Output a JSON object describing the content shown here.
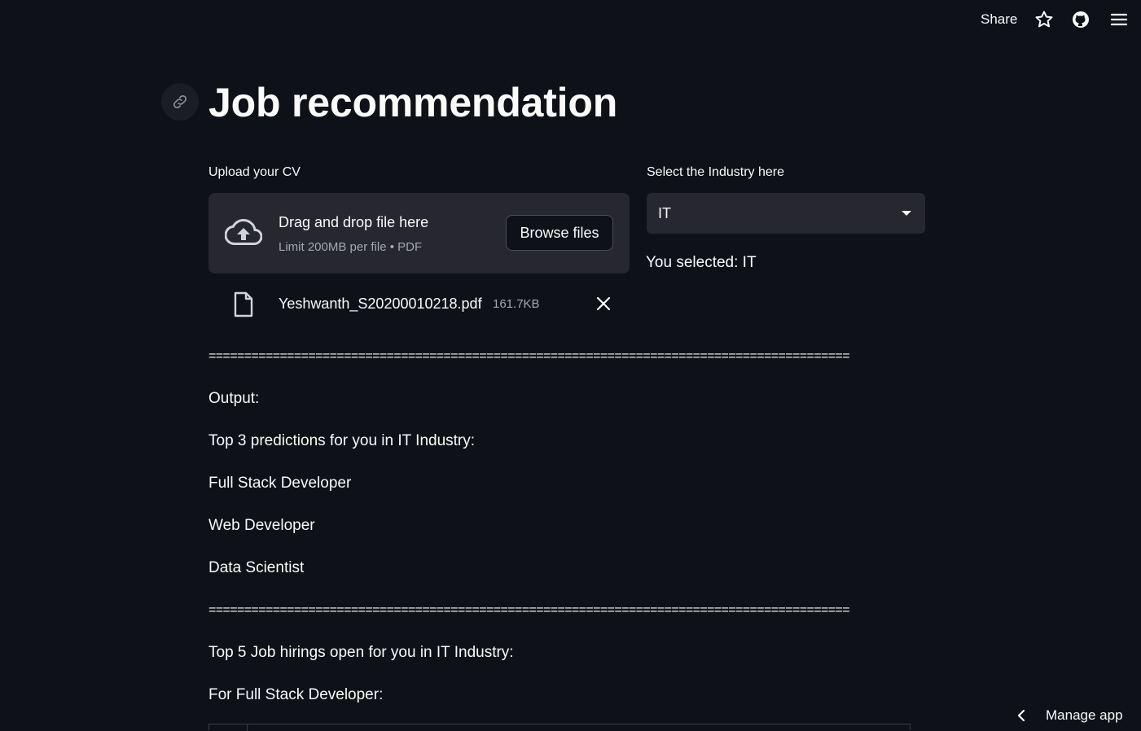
{
  "header": {
    "share_label": "Share",
    "icons": [
      "star-icon",
      "github-icon",
      "hamburger-menu-icon"
    ]
  },
  "page": {
    "title": "Job recommendation",
    "anchor_icon": "link-icon"
  },
  "uploader": {
    "label": "Upload your CV",
    "drag_text": "Drag and drop file here",
    "limit_text": "Limit 200MB per file • PDF",
    "browse_label": "Browse files",
    "file": {
      "name": "Yeshwanth_S20200010218.pdf",
      "size": "161.7KB"
    }
  },
  "industry": {
    "label": "Select the Industry here",
    "selected": "IT",
    "selected_text": "You selected: IT"
  },
  "separator": "==========================================================================================",
  "output": {
    "heading": "Output:",
    "predictions_heading": "Top 3 predictions for you in IT Industry:",
    "predictions": [
      "Full Stack Developer",
      "Web Developer",
      "Data Scientist"
    ],
    "hirings_heading": "Top 5 Job hirings open for you in IT Industry:",
    "for_role": "For Full Stack Developer:"
  },
  "footer": {
    "manage_app_label": "Manage app"
  },
  "colors": {
    "background": "#0e1117",
    "widget_bg": "#262730",
    "text": "#fafafa",
    "muted_text": "#a3a8b4"
  }
}
